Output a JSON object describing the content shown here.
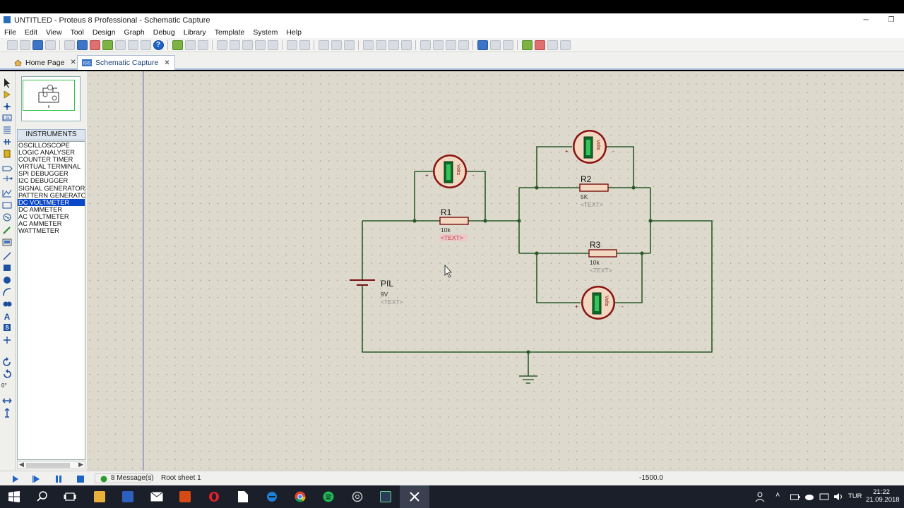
{
  "window": {
    "title": "UNTITLED - Proteus 8 Professional - Schematic Capture",
    "min_btn": "─",
    "max_btn": "❐"
  },
  "menu": [
    "File",
    "Edit",
    "View",
    "Tool",
    "Design",
    "Graph",
    "Debug",
    "Library",
    "Template",
    "System",
    "Help"
  ],
  "tabs": [
    {
      "label": "Home Page",
      "close": "✕"
    },
    {
      "label": "Schematic Capture",
      "close": "✕",
      "icon_text": "ISIS"
    }
  ],
  "toolbar": {
    "help_icon": "?"
  },
  "left_toolbar": {
    "rotation": "0°"
  },
  "instruments": {
    "header": "INSTRUMENTS",
    "items": [
      "OSCILLOSCOPE",
      "LOGIC ANALYSER",
      "COUNTER TIMER",
      "VIRTUAL TERMINAL",
      "SPI DEBUGGER",
      "I2C DEBUGGER",
      "SIGNAL GENERATOR",
      "PATTERN GENERATO",
      "DC VOLTMETER",
      "DC AMMETER",
      "AC VOLTMETER",
      "AC AMMETER",
      "WATTMETER"
    ],
    "selected": 8
  },
  "schematic": {
    "battery": {
      "name": "PIL",
      "value": "9V",
      "text": "<TEXT>"
    },
    "r1": {
      "name": "R1",
      "value": "10k",
      "text": "<TEXT>"
    },
    "r2": {
      "name": "R2",
      "value": "5K",
      "text": "<TEXT>"
    },
    "r3": {
      "name": "R3",
      "value": "10k",
      "text": "<TEXT>"
    },
    "meter_label": "Volts",
    "plus": "+",
    "minus": "-"
  },
  "status": {
    "messages": "8 Message(s)",
    "sheet": "Root sheet 1",
    "coord": "-1500.0"
  },
  "tray": {
    "language": "TUR",
    "time": "21:22",
    "date": "21.09.2018"
  },
  "colors": {
    "wire": "#2a5a2a",
    "component": "#7a1010",
    "meter_fill": "#f2d8c0",
    "selection": "#0a47c9",
    "canvas": "#ddd9cc"
  }
}
